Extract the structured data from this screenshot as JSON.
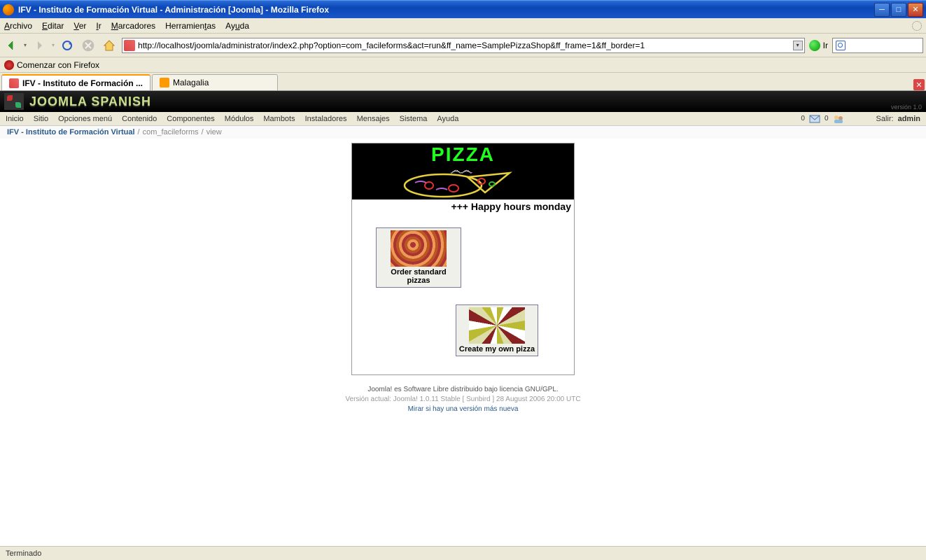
{
  "window": {
    "title": "IFV - Instituto de Formación Virtual - Administración [Joomla] - Mozilla Firefox"
  },
  "firefox_menu": [
    "Archivo",
    "Editar",
    "Ver",
    "Ir",
    "Marcadores",
    "Herramientas",
    "Ayuda"
  ],
  "nav": {
    "url": "http://localhost/joomla/administrator/index2.php?option=com_facileforms&act=run&ff_name=SamplePizzaShop&ff_frame=1&ff_border=1",
    "go_label": "Ir"
  },
  "bookmark_bar": {
    "item1": "Comenzar con Firefox"
  },
  "tabs": {
    "tab1": "IFV - Instituto de Formación ...",
    "tab2": "Malagalia"
  },
  "joomla_header": {
    "brand": "JOOMLA SPANISH",
    "version": "versión 1.0"
  },
  "joomla_menu": [
    "Inicio",
    "Sitio",
    "Opciones menú",
    "Contenido",
    "Componentes",
    "Módulos",
    "Mambots",
    "Instaladores",
    "Mensajes",
    "Sistema",
    "Ayuda"
  ],
  "joomla_right": {
    "count_msg": "0",
    "count_usr": "0",
    "logout": "Salir:",
    "user": "admin"
  },
  "breadcrumb": {
    "link": "IFV - Instituto de Formación Virtual",
    "part2": "com_facileforms",
    "part3": "view"
  },
  "pizza": {
    "header": "PIZZA",
    "marquee": "+++ Happy hours monday",
    "card1_label": "Order standard pizzas",
    "card2_label": "Create my own pizza"
  },
  "footer": {
    "line1": "Joomla! es Software Libre distribuido bajo licencia GNU/GPL.",
    "line2": "Versión actual: Joomla! 1.0.11 Stable [ Sunbird ] 28 August 2006 20:00 UTC",
    "line3": "Mirar si hay una versión más nueva"
  },
  "statusbar": "Terminado"
}
